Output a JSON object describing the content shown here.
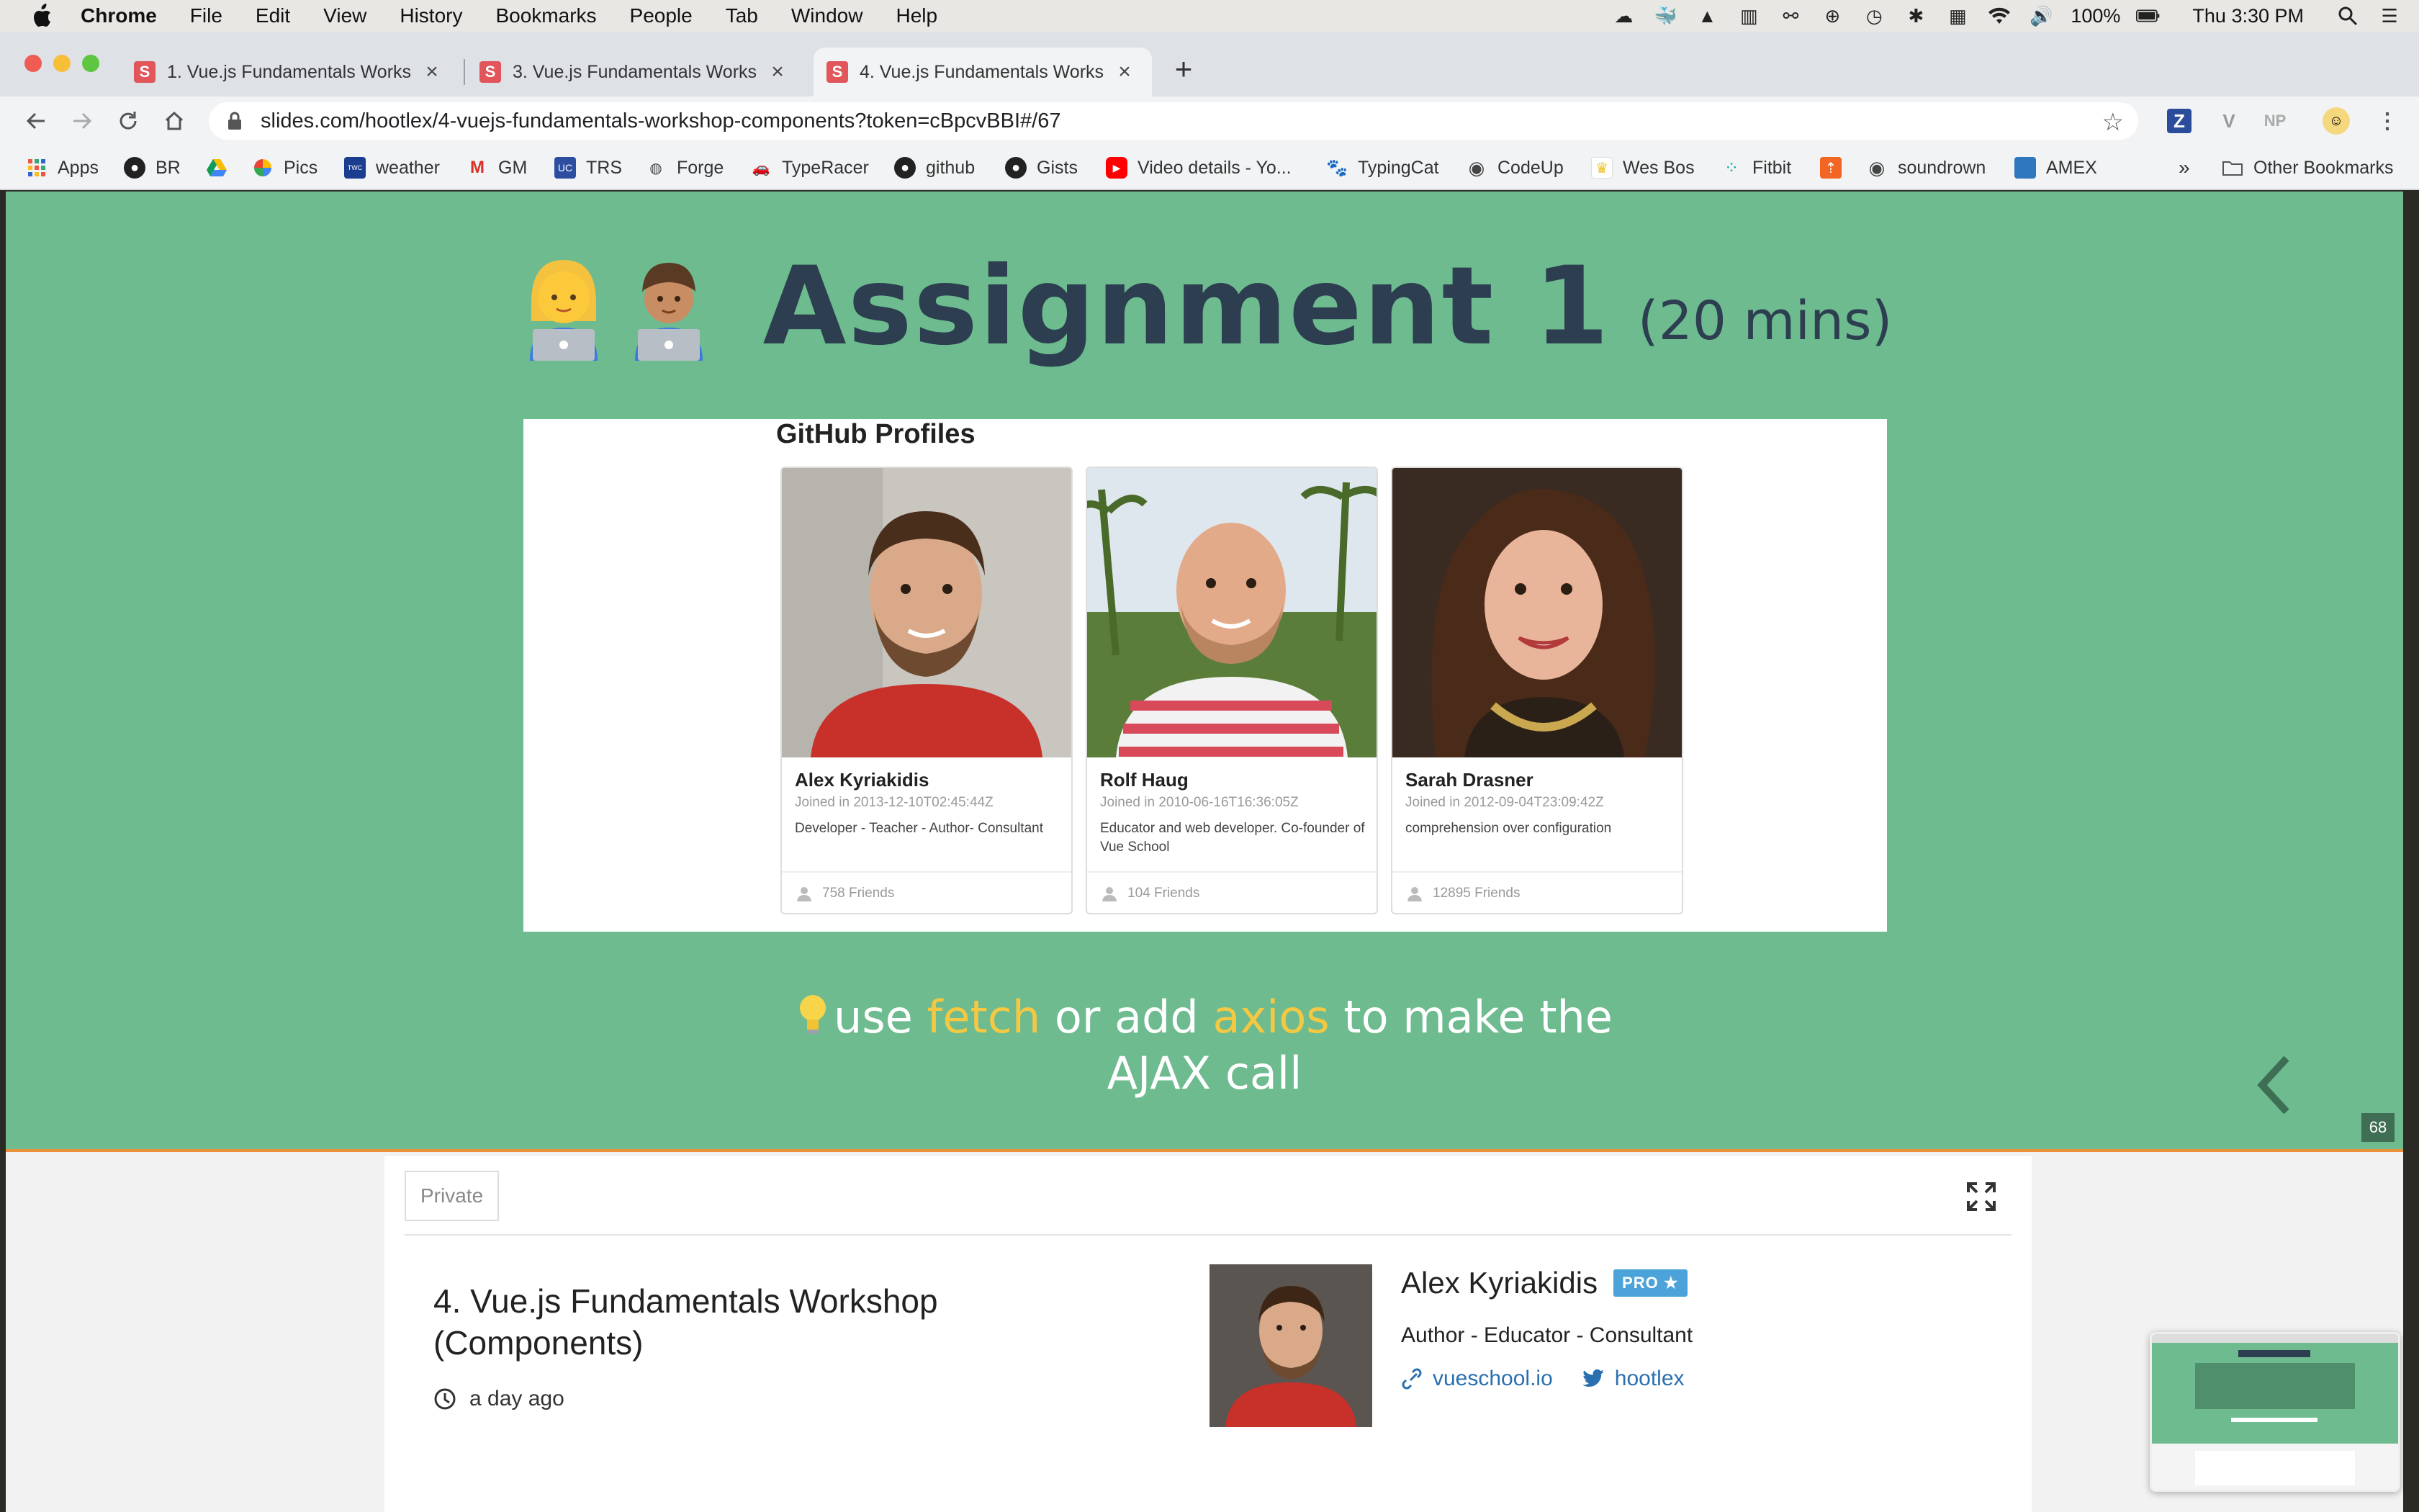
{
  "menubar": {
    "app": "Chrome",
    "items": [
      "File",
      "Edit",
      "View",
      "History",
      "Bookmarks",
      "People",
      "Tab",
      "Window",
      "Help"
    ],
    "battery": "100%",
    "clock": "Thu 3:30 PM"
  },
  "tabs": [
    {
      "favicon": "S",
      "title": "1. Vue.js Fundamentals Workshop"
    },
    {
      "favicon": "S",
      "title": "3. Vue.js Fundamentals Workshop"
    },
    {
      "favicon": "S",
      "title": "4. Vue.js Fundamentals Workshop"
    }
  ],
  "address_bar": {
    "url": "slides.com/hootlex/4-vuejs-fundamentals-workshop-components?token=cBpcvBBI#/67"
  },
  "extensions": [
    "Z",
    "V",
    "NP"
  ],
  "bookmarks": {
    "items": [
      {
        "label": "Apps",
        "icon": "apps-grid-icon"
      },
      {
        "label": "BR",
        "icon": "github-icon"
      },
      {
        "label": "",
        "icon": "google-drive-icon"
      },
      {
        "label": "Pics",
        "icon": "google-photos-icon"
      },
      {
        "label": "weather",
        "icon": "weather-channel-icon"
      },
      {
        "label": "GM",
        "icon": "gmail-icon"
      },
      {
        "label": "TRS",
        "icon": "uc-icon"
      },
      {
        "label": "Forge",
        "icon": "forge-icon"
      },
      {
        "label": "TypeRacer",
        "icon": "typeracer-icon"
      },
      {
        "label": "github",
        "icon": "github-icon"
      },
      {
        "label": "Gists",
        "icon": "github-icon"
      },
      {
        "label": "Video details - Yo...",
        "icon": "youtube-icon"
      },
      {
        "label": "TypingCat",
        "icon": "paw-icon"
      },
      {
        "label": "CodeUp",
        "icon": "globe-icon"
      },
      {
        "label": "Wes Bos",
        "icon": "crown-icon"
      },
      {
        "label": "Fitbit",
        "icon": "fitbit-icon"
      },
      {
        "label": "",
        "icon": "arrow-up-icon"
      },
      {
        "label": "soundrown",
        "icon": "globe-icon"
      },
      {
        "label": "AMEX",
        "icon": "amex-icon"
      }
    ],
    "overflow": "»",
    "other": "Other Bookmarks"
  },
  "slide": {
    "title": "Assignment 1",
    "duration": "(20 mins)",
    "screenshot": {
      "heading": "GitHub Profiles",
      "profiles": [
        {
          "name": "Alex Kyriakidis",
          "joined": "Joined in 2013-12-10T02:45:44Z",
          "bio": "Developer - Teacher - Author- Consultant",
          "friends": "758 Friends"
        },
        {
          "name": "Rolf Haug",
          "joined": "Joined in 2010-06-16T16:36:05Z",
          "bio": "Educator and web developer. Co-founder of Vue School",
          "friends": "104 Friends"
        },
        {
          "name": "Sarah Drasner",
          "joined": "Joined in 2012-09-04T23:09:42Z",
          "bio": "comprehension over configuration",
          "friends": "12895 Friends"
        }
      ]
    },
    "hint": {
      "part1": "use ",
      "kw1": "fetch",
      "part2": " or add ",
      "kw2": "axios",
      "part3": " to make the",
      "line2": "AJAX call"
    },
    "slide_number": "68",
    "colors": {
      "background": "#6dbb8f",
      "title": "#2c3e50",
      "keyword": "#f4c843",
      "accent_border": "#e9913b"
    }
  },
  "deck": {
    "visibility": "Private",
    "title": "4. Vue.js Fundamentals Workshop (Components)",
    "time": "a day ago",
    "author": {
      "name": "Alex Kyriakidis",
      "badge": "PRO ★",
      "bio": "Author - Educator - Consultant",
      "website": "vueschool.io",
      "twitter": "hootlex"
    }
  }
}
